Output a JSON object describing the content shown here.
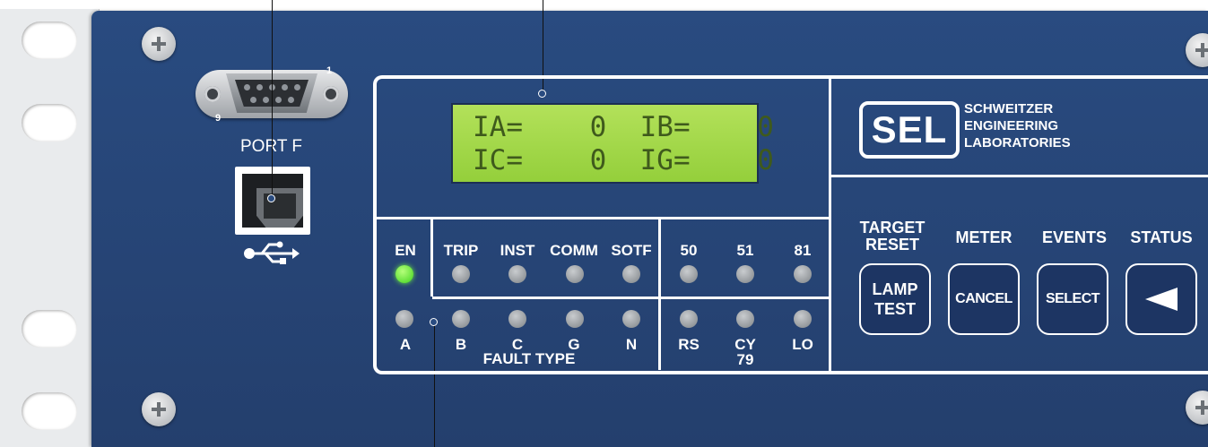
{
  "ports": {
    "serial_label": "PORT F",
    "serial_pin_first": "1",
    "serial_pin_last": "9"
  },
  "lcd": {
    "line1": "IA=    0  IB=    0",
    "line2": "IC=    0  IG=    0",
    "background_color": "#a6da4d"
  },
  "indicators": {
    "enable": {
      "label": "EN",
      "state": "on",
      "color": "#3fd31d"
    },
    "top_row": [
      "TRIP",
      "INST",
      "COMM",
      "SOTF"
    ],
    "fault_type_row": [
      "B",
      "C",
      "G",
      "N"
    ],
    "fault_a": "A",
    "fault_type_caption": "FAULT TYPE",
    "protection_top": [
      "50",
      "51",
      "81"
    ],
    "protection_bottom": [
      "RS",
      "CY",
      "LO"
    ],
    "cy_sub": "79"
  },
  "brand": {
    "logo": "SEL",
    "name_line1": "SCHWEITZER",
    "name_line2": "ENGINEERING",
    "name_line3": "LABORATORIES"
  },
  "buttons": {
    "target_reset_line1": "TARGET",
    "target_reset_line2": "RESET",
    "lamp_test_line1": "LAMP",
    "lamp_test_line2": "TEST",
    "meter": "METER",
    "cancel": "CANCEL",
    "events": "EVENTS",
    "select": "SELECT",
    "status": "STATUS",
    "left_arrow_icon": "left-arrow-icon"
  },
  "colors": {
    "panel": "#294b80",
    "button": "#1d3563"
  }
}
